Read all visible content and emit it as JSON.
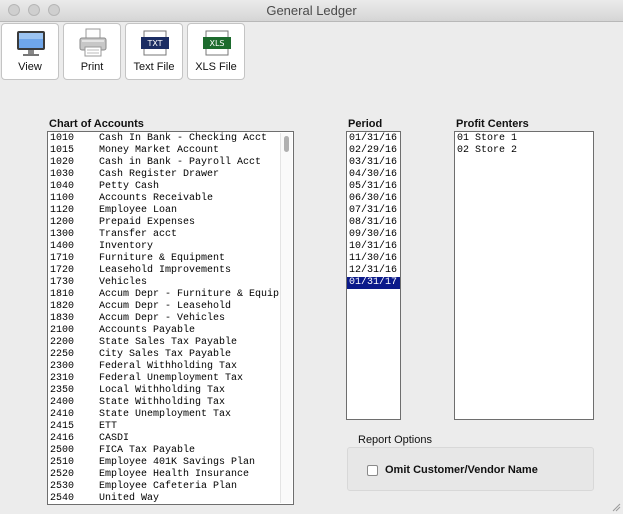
{
  "window": {
    "title": "General Ledger"
  },
  "toolbar": {
    "buttons": [
      {
        "label": "View",
        "icon": "monitor-icon"
      },
      {
        "label": "Print",
        "icon": "printer-icon"
      },
      {
        "label": "Text File",
        "icon": "txt-file-icon",
        "badge": "TXT"
      },
      {
        "label": "XLS File",
        "icon": "xls-file-icon",
        "badge": "XLS"
      }
    ]
  },
  "chart_of_accounts": {
    "label": "Chart of Accounts",
    "items": [
      {
        "code": "1010",
        "name": "Cash In Bank - Checking Acct"
      },
      {
        "code": "1015",
        "name": "Money Market Account"
      },
      {
        "code": "1020",
        "name": "Cash in Bank - Payroll Acct"
      },
      {
        "code": "1030",
        "name": "Cash Register Drawer"
      },
      {
        "code": "1040",
        "name": "Petty Cash"
      },
      {
        "code": "1100",
        "name": "Accounts Receivable"
      },
      {
        "code": "1120",
        "name": "Employee Loan"
      },
      {
        "code": "1200",
        "name": "Prepaid Expenses"
      },
      {
        "code": "1300",
        "name": "Transfer acct"
      },
      {
        "code": "1400",
        "name": "Inventory"
      },
      {
        "code": "1710",
        "name": "Furniture & Equipment"
      },
      {
        "code": "1720",
        "name": "Leasehold Improvements"
      },
      {
        "code": "1730",
        "name": "Vehicles"
      },
      {
        "code": "1810",
        "name": "Accum Depr - Furniture & Equip"
      },
      {
        "code": "1820",
        "name": "Accum Depr - Leasehold"
      },
      {
        "code": "1830",
        "name": "Accum Depr - Vehicles"
      },
      {
        "code": "2100",
        "name": "Accounts Payable"
      },
      {
        "code": "2200",
        "name": "State Sales Tax Payable"
      },
      {
        "code": "2250",
        "name": "City Sales Tax Payable"
      },
      {
        "code": "2300",
        "name": "Federal Withholding Tax"
      },
      {
        "code": "2310",
        "name": "Federal Unemployment Tax"
      },
      {
        "code": "2350",
        "name": "Local Withholding Tax"
      },
      {
        "code": "2400",
        "name": "State Withholding Tax"
      },
      {
        "code": "2410",
        "name": "State Unemployment Tax"
      },
      {
        "code": "2415",
        "name": "ETT"
      },
      {
        "code": "2416",
        "name": "CASDI"
      },
      {
        "code": "2500",
        "name": "FICA Tax Payable"
      },
      {
        "code": "2510",
        "name": "Employee 401K Savings Plan"
      },
      {
        "code": "2520",
        "name": "Employee Health Insurance"
      },
      {
        "code": "2530",
        "name": "Employee Cafeteria Plan"
      },
      {
        "code": "2540",
        "name": "United Way"
      }
    ]
  },
  "period": {
    "label": "Period",
    "items": [
      "01/31/16",
      "02/29/16",
      "03/31/16",
      "04/30/16",
      "05/31/16",
      "06/30/16",
      "07/31/16",
      "08/31/16",
      "09/30/16",
      "10/31/16",
      "11/30/16",
      "12/31/16",
      "01/31/17"
    ],
    "selected": "01/31/17"
  },
  "profit_centers": {
    "label": "Profit Centers",
    "items": [
      "01 Store 1",
      "02 Store 2"
    ]
  },
  "report_options": {
    "label": "Report Options",
    "omit_label": "Omit Customer/Vendor Name",
    "omit_checked": false
  },
  "colors": {
    "selection": "#0b1a8a",
    "background": "#ececec"
  }
}
